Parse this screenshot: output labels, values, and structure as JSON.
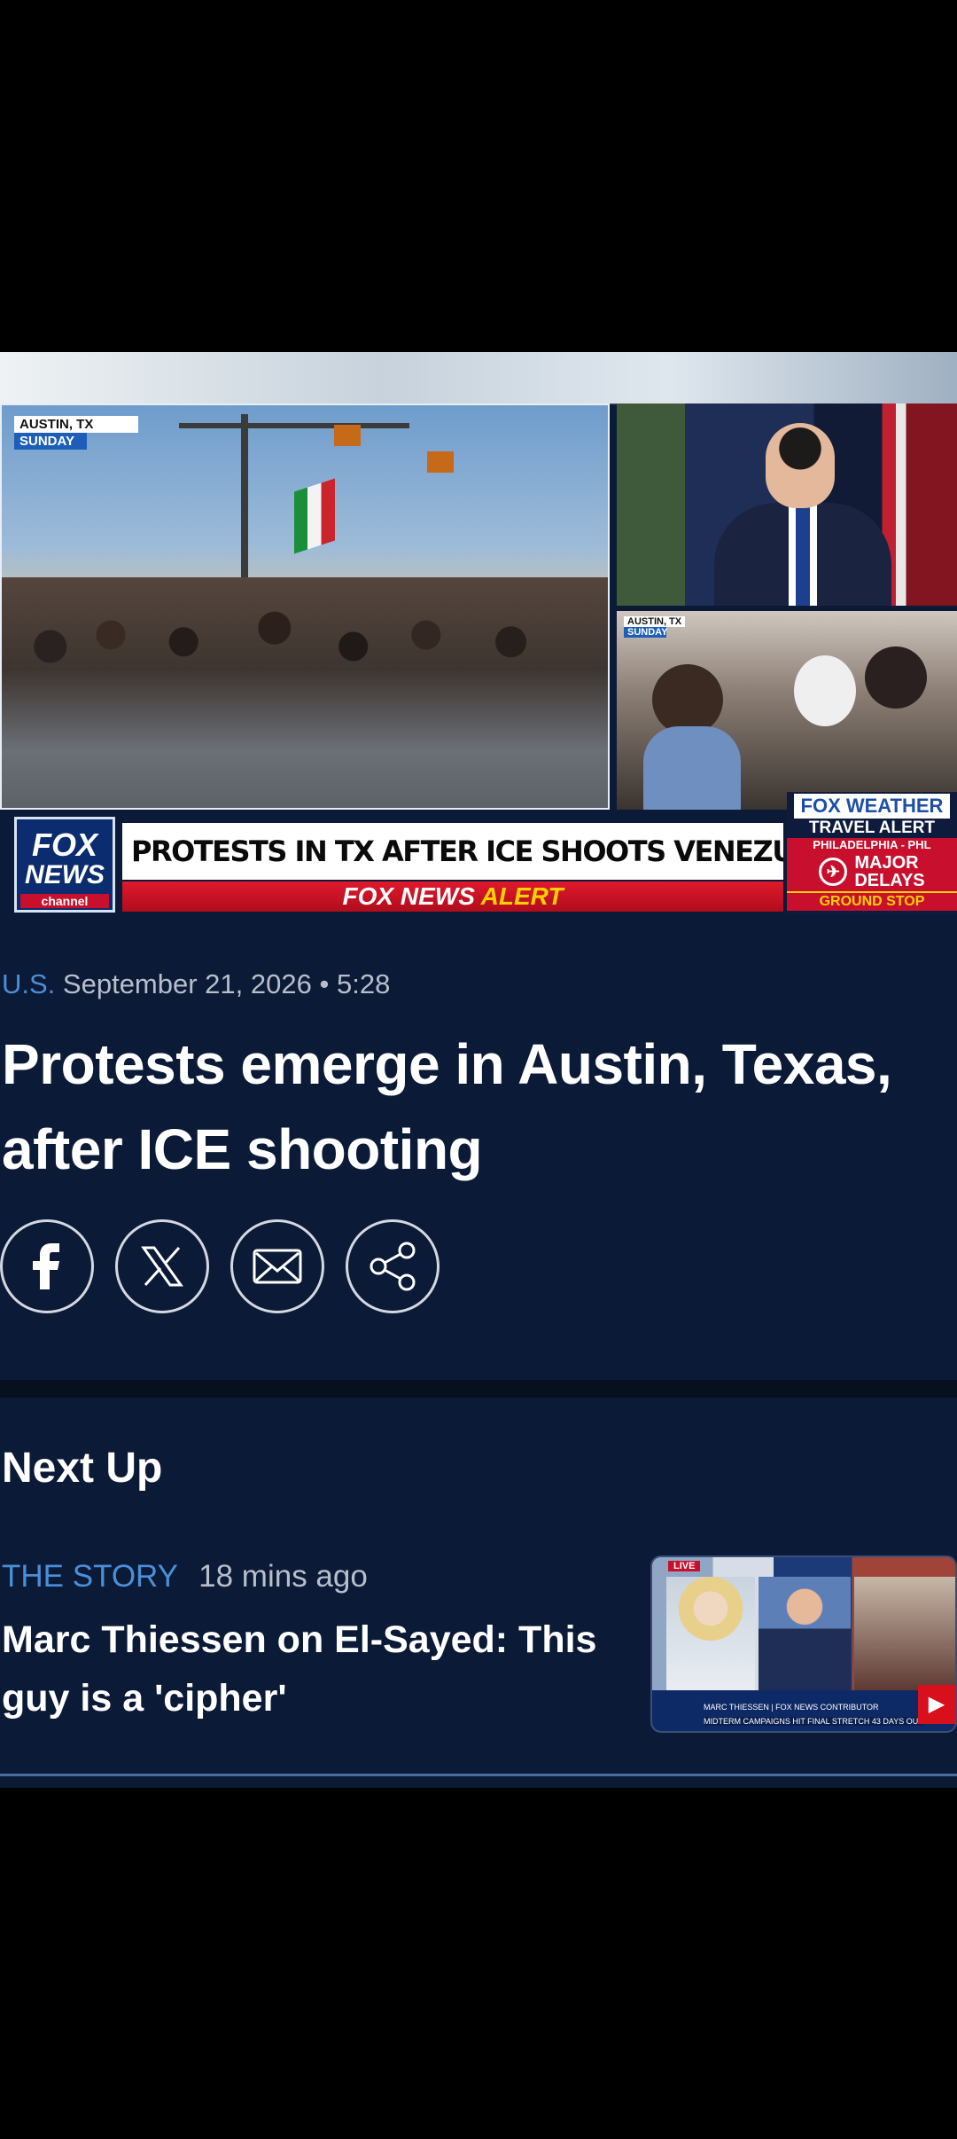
{
  "video": {
    "location_label": "AUSTIN, TX",
    "day_label": "SUNDAY",
    "side_location_label": "AUSTIN, TX",
    "side_day_label": "SUNDAY",
    "logo_fox": "FOX",
    "logo_news": "NEWS",
    "logo_channel": "channel",
    "headline": "PROTESTS IN TX AFTER ICE SHOOTS VENEZUELAN MIGRANT",
    "alert_prefix": "FOX NEWS",
    "alert_word": "ALERT",
    "weather_logo": "FOX WEATHER",
    "weather_sub": "TRAVEL ALERT",
    "weather_city": "PHILADELPHIA - PHL",
    "weather_major": "MAJOR",
    "weather_delays": "DELAYS",
    "weather_stop": "GROUND STOP",
    "play_icon": "play-icon"
  },
  "article": {
    "category": "U.S.",
    "date": "September 21, 2026",
    "separator": "•",
    "duration": "5:28",
    "title": "Protests emerge in Austin, Texas, after ICE shooting",
    "share_icons": [
      "facebook-icon",
      "x-icon",
      "email-icon",
      "share-icon"
    ]
  },
  "next_up": {
    "heading": "Next Up",
    "show": "THE STORY",
    "time_ago": "18 mins ago",
    "title": "Marc Thiessen on El-Sayed: This guy is a 'cipher'",
    "thumb_live": "LIVE",
    "thumb_lower": "MARC THIESSEN | FOX NEWS CONTRIBUTOR",
    "thumb_lower2": "MIDTERM CAMPAIGNS HIT FINAL STRETCH 43 DAYS OUT"
  },
  "colors": {
    "background": "#0b1a36",
    "accent_blue": "#4a8fd8",
    "alert_red": "#c8102e",
    "alert_yellow": "#ffd200"
  }
}
